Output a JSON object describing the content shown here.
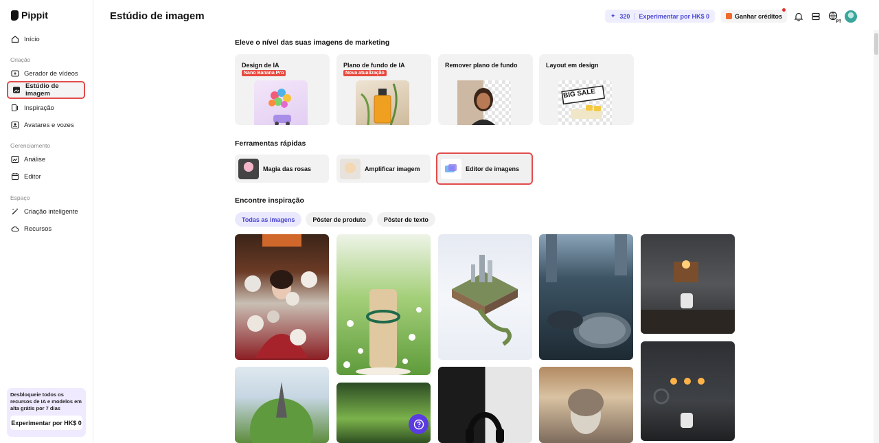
{
  "brand": {
    "name": "Pippit"
  },
  "sidebar": {
    "home": "Início",
    "sections": [
      "Criação",
      "Gerenciamento",
      "Espaço"
    ],
    "creation": [
      "Gerador de vídeos",
      "Estúdio de imagem",
      "Inspiração",
      "Avatares e vozes"
    ],
    "management": [
      "Análise",
      "Editor"
    ],
    "space": [
      "Criação inteligente",
      "Recursos"
    ],
    "promo_text": "Desbloqueie todos os recursos de IA e modelos em alta grátis por 7 dias",
    "promo_button": "Experimentar por HK$ 0"
  },
  "header": {
    "title": "Estúdio de imagem",
    "credits": "320",
    "trial": "Experimentar por HK$ 0",
    "earn": "Ganhar créditos",
    "lang_badge": "PT"
  },
  "main": {
    "marketing_title": "Eleve o nível das suas imagens de marketing",
    "features": [
      {
        "title": "Design de IA",
        "badge": "Nano Banana Pro"
      },
      {
        "title": "Plano de fundo de IA",
        "badge": "Nova atualização"
      },
      {
        "title": "Remover plano de fundo",
        "badge": ""
      },
      {
        "title": "Layout em design",
        "badge": ""
      }
    ],
    "big_sale": "BIG SALE",
    "quick_title": "Ferramentas rápidas",
    "quick_tools": [
      "Magia das rosas",
      "Amplificar imagem",
      "Editor de imagens"
    ],
    "inspiration_title": "Encontre inspiração",
    "tabs": [
      "Todas as imagens",
      "Pôster de produto",
      "Pôster de texto"
    ]
  },
  "colors": {
    "accent": "#4e4bd6",
    "highlight": "#e34b4b",
    "help": "#5a3ce0"
  }
}
